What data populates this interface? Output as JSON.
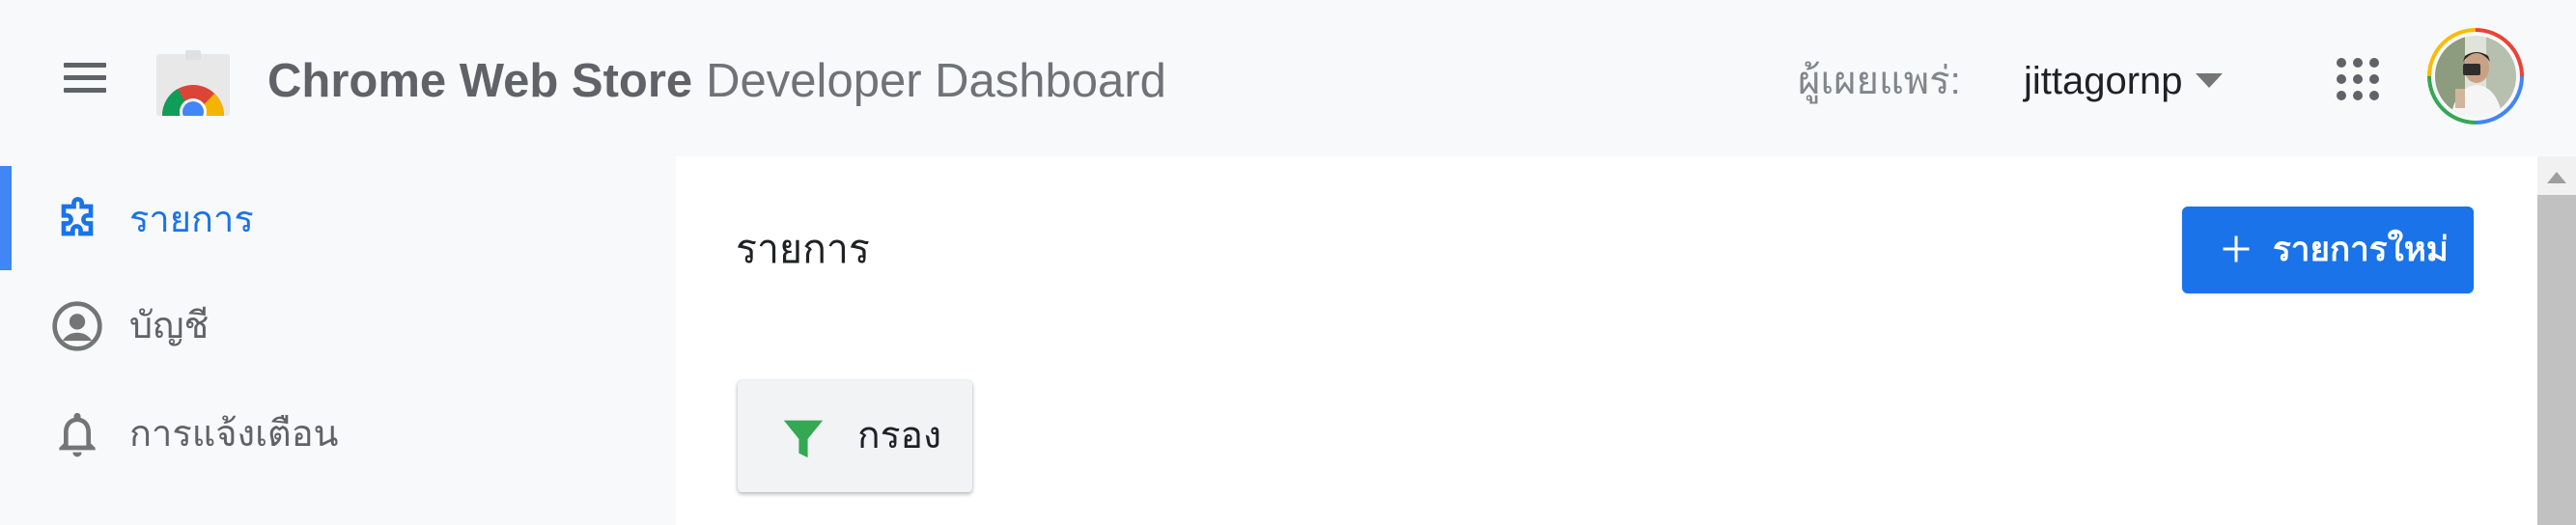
{
  "header": {
    "brand_bold": "Chrome Web Store",
    "brand_light": "Developer Dashboard",
    "publisher_label": "ผู้เผยแพร่:",
    "publisher_name": "jittagornp",
    "icons": {
      "menu": "hamburger-menu-icon",
      "logo": "chrome-web-store-logo",
      "caret": "dropdown-caret-icon",
      "apps": "google-apps-grid-icon",
      "avatar": "account-avatar"
    }
  },
  "sidebar": {
    "items": [
      {
        "label": "รายการ",
        "icon": "puzzle-extension-icon",
        "active": true
      },
      {
        "label": "บัญชี",
        "icon": "account-circle-icon",
        "active": false
      },
      {
        "label": "การแจ้งเตือน",
        "icon": "bell-icon",
        "active": false
      }
    ]
  },
  "main": {
    "title": "รายการ",
    "new_item_label": "รายการใหม่",
    "filter_label": "กรอง"
  },
  "colors": {
    "accent": "#1a73e8",
    "active_indicator": "#4285f4",
    "filter_icon": "#34a853",
    "header_bg": "#f8f9fa"
  }
}
